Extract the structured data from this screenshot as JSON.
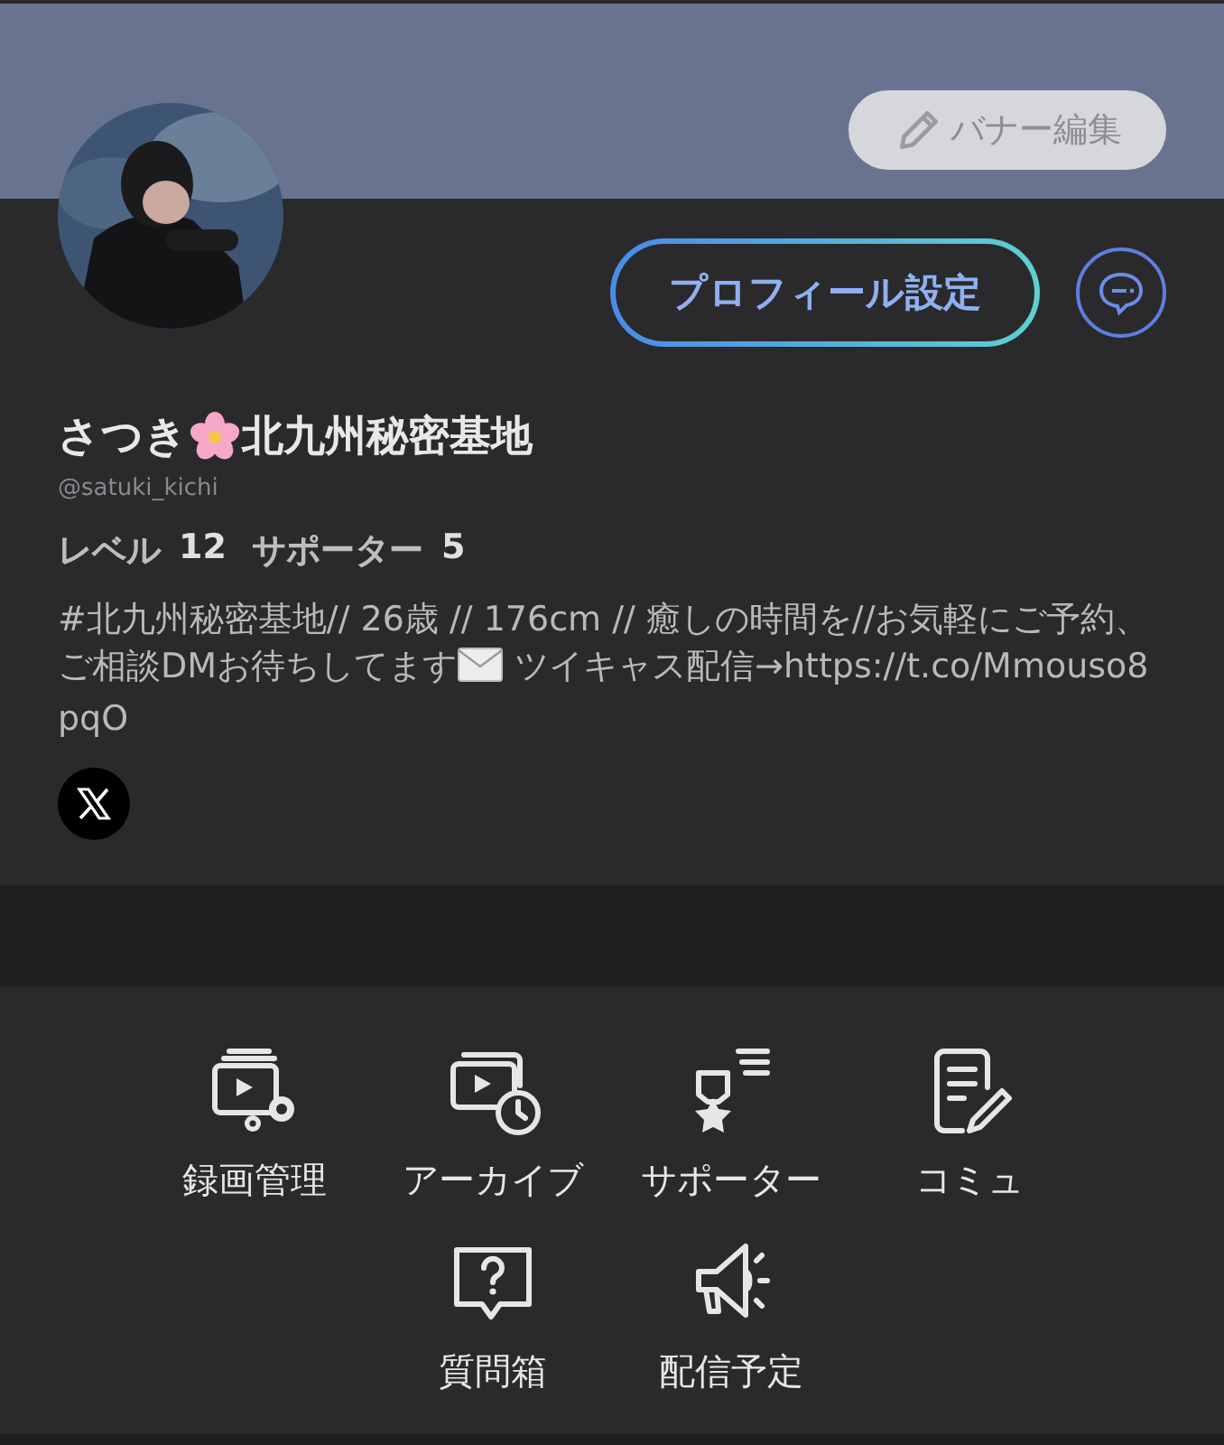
{
  "banner": {
    "edit_button": "バナー編集"
  },
  "profile": {
    "settings_button": "プロフィール設定",
    "name_before": "さつき",
    "name_after": "北九州秘密基地",
    "handle": "@satuki_kichi",
    "stats": [
      {
        "label": "レベル",
        "value": "12"
      },
      {
        "label": "サポーター",
        "value": "5"
      }
    ],
    "bio": [
      {
        "kind": "text",
        "text": "#北九州秘密基地// 26歳 // 176cm // 癒しの時間を//お気軽にご予約、ご相談DMお待ちしてます"
      },
      {
        "kind": "envelope"
      },
      {
        "kind": "text",
        "text": " ツイキャス配信→https://t.co/Mmouso8pqO"
      }
    ]
  },
  "menu": [
    {
      "label": "録画管理"
    },
    {
      "label": "アーカイブ"
    },
    {
      "label": "サポーター"
    },
    {
      "label": "コミュ"
    },
    {
      "label": "質問箱"
    },
    {
      "label": "配信予定"
    }
  ]
}
